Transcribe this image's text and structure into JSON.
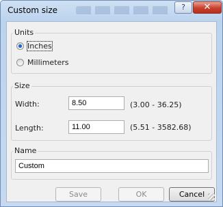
{
  "window": {
    "title": "Custom size",
    "help_label": "?",
    "close_label": "✕"
  },
  "units": {
    "group_label": "Units",
    "options": [
      {
        "label": "Inches",
        "selected": true
      },
      {
        "label": "Millimeters",
        "selected": false
      }
    ]
  },
  "size": {
    "group_label": "Size",
    "width": {
      "label": "Width:",
      "value": "8.50",
      "range": "(3.00 - 36.25)"
    },
    "length": {
      "label": "Length:",
      "value": "11.00",
      "range": "(5.51 - 3582.68)"
    }
  },
  "name": {
    "group_label": "Name",
    "value": "Custom"
  },
  "buttons": {
    "save_label": "Save",
    "ok_label": "OK",
    "cancel_label": "Cancel"
  },
  "colors": {
    "titlebar": "#bcd3ee",
    "dialog_bg": "#f0f0f0",
    "close_button": "#c8402c",
    "radio_selected": "#1d64c8"
  }
}
